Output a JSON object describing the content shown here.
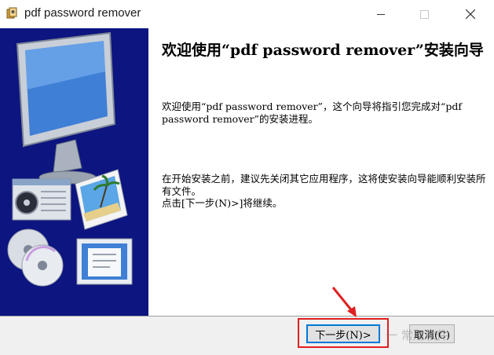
{
  "window": {
    "title": "pdf password remover",
    "accent_colors": {
      "banner": "#0d1580",
      "highlight": "#e02020",
      "focus": "#0078d7"
    },
    "icons": [
      "app-icon",
      "minimize-icon",
      "maximize-icon",
      "close-icon"
    ]
  },
  "wizard": {
    "heading": "欢迎使用“pdf password remover”安装向导",
    "para1": "欢迎使用“pdf password remover”，这个向导将指引您完成对“pdf password remover”的安装进程。",
    "para2": "在开始安装之前，建议先关闭其它应用程序，这将使安装向导能顺利安装所有文件。",
    "para3": "点击[下一步(N)>]将继续。"
  },
  "buttons": {
    "next_label": "下一步(N)>",
    "cancel_label": "取消(C)"
  },
  "watermark": "一 常用软件"
}
